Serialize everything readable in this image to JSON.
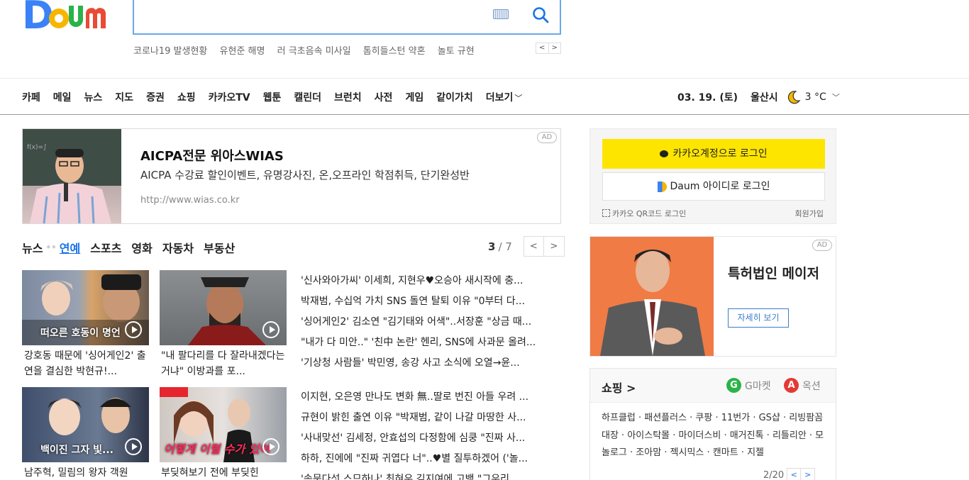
{
  "header": {
    "logo_text": "Daum",
    "trending": [
      "코로나19 발생현황",
      "유현준 해명",
      "러 극초음속 미사일",
      "톰히들스턴 약혼",
      "놀토 규현"
    ],
    "trend_prev": "<",
    "trend_next": ">"
  },
  "gnb": {
    "items": [
      "카페",
      "메일",
      "뉴스",
      "지도",
      "증권",
      "쇼핑",
      "카카오TV",
      "웹툰",
      "캘린더",
      "브런치",
      "사전",
      "게임",
      "같이가치",
      "더보기"
    ],
    "more_chevron": "﹀",
    "date": "03. 19. (토)",
    "city": "울산시",
    "temp": "3 °C",
    "weather_chevron": "﹀"
  },
  "ad_top": {
    "title": "AICPA전문 위아스WIAS",
    "desc": "AICPA 수강료 할인이벤트, 유명강사진, 온,오프라인 학점취득, 단기완성반",
    "url": "http://www.wias.co.kr",
    "badge": "AD"
  },
  "news": {
    "tabs": [
      "뉴스",
      "연예",
      "스포츠",
      "영화",
      "자동차",
      "부동산"
    ],
    "page_current": "3",
    "page_total": "/ 7",
    "thumbs": [
      {
        "caption": "떠오른 호동이 명언",
        "title": "강호동 때문에 '싱어게인2' 출연을 결심한 박현규!..."
      },
      {
        "caption": "",
        "title": "\"내 팔다리를 다 잘라내겠다는 거냐\" 이방과를 포..."
      },
      {
        "caption": "백이진 그자 빛...",
        "title": "남주혁, 밀림의 왕자 객원"
      },
      {
        "caption": "어떻게 이럴 수가 있어",
        "title": "부딪혀보기 전에 부딪힌"
      }
    ],
    "headlines_top": [
      "'신사와아가씨' 이세희, 지현우♥오승아 새시작에 충...",
      "박재범, 수십억 가치 SNS 돌연 탈퇴 이유 \"0부터 다...",
      "'싱어게인2' 김소연 \"김기태와 어색\"..서장훈 \"상금 때...",
      "\"내가 다 미안..\" '친中 논란' 헨리, SNS에 사과문 올려...",
      "'기상청 사람들' 박민영, 송강 사고 소식에 오열→윤..."
    ],
    "headlines_bottom": [
      "이지현, 오은영 만나도 변화 無..딸로 번진 아들 우려 ...",
      "규현이 밝힌 출연 이유 \"박재범, 같이 나갈 마땅한 사...",
      "'사내맞선' 김세정, 안효섭의 다정함에 심쿵 \"진짜 사...",
      "하하, 진에에 \"진짜 귀엽다 너\"..♥별 질투하겠어 ('놀...",
      "'속문다섯 스므하나' 최혀우 김지여에 고백 \"그우리..."
    ]
  },
  "login": {
    "kakao_label": "카카오계정으로 로그인",
    "daum_label": "Daum 아이디로 로그인",
    "qr_label": "카카오 QR코드 로그인",
    "signup_label": "회원가입"
  },
  "ad_right": {
    "title": "특허법인 메이저",
    "more_label": "자세히 보기",
    "badge": "AD"
  },
  "shopping": {
    "title": "쇼핑 >",
    "gmarket": "G마켓",
    "auction": "옥션",
    "list_text": "하프클럽 · 패션플러스 · 쿠팡 · 11번가 · GS샵 · 리빙팜꼼대장 · 아이스탁몰 · 마이더스비 · 매거진톡 · 리틀리안 · 모놀로그 · 조아맘 · 젝시믹스 · 캔마트 · 지젤",
    "page": "2/20"
  },
  "colors": {
    "accent": "#1a73e8",
    "kakao_yellow": "#fee500",
    "search_border": "#6aa9e9"
  }
}
